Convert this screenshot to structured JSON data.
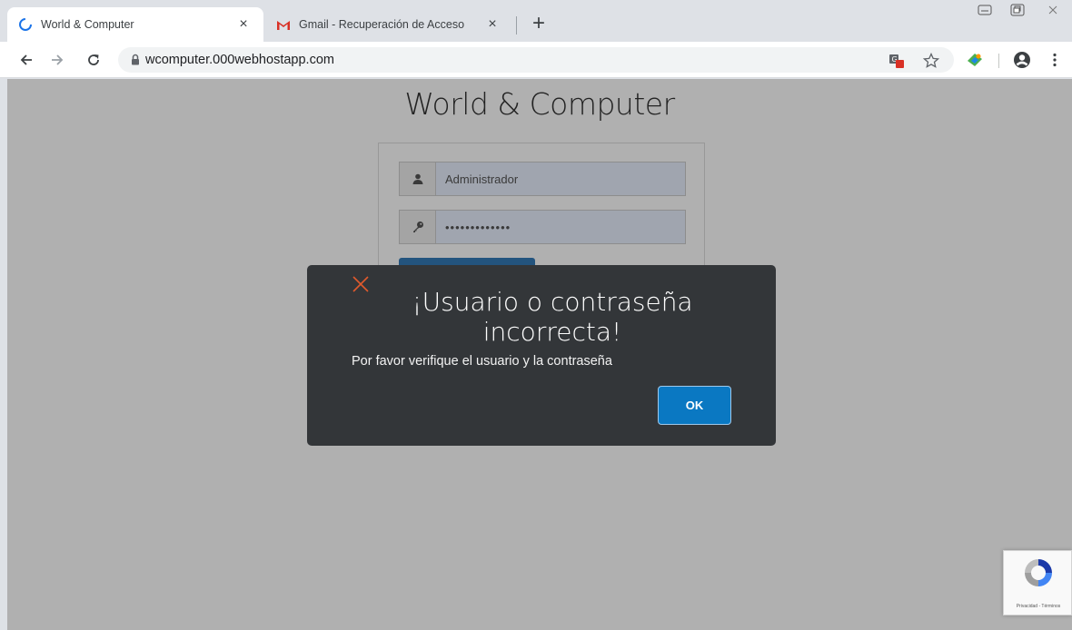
{
  "tabs": [
    {
      "title": "World & Computer",
      "favicon": "loading-spinner-icon",
      "close": "×"
    },
    {
      "title": "Gmail - Recuperación de Acceso",
      "favicon": "gmail-icon",
      "close": "×"
    }
  ],
  "newtab_label": "+",
  "toolbar": {
    "url": "wcomputer.000webhostapp.com"
  },
  "page": {
    "site_title": "World & Computer",
    "username_value": "Administrador",
    "password_value": "•••••••••••••"
  },
  "dialog": {
    "title": "¡Usuario o contraseña incorrecta!",
    "message": "Por favor verifique el usuario y la contraseña",
    "ok_label": "OK"
  },
  "recaptcha": {
    "footer": "Privacidad - Términos"
  },
  "colors": {
    "dialog_bg": "#333639",
    "ok_button": "#0a78c2",
    "close_x": "#e05a2c"
  }
}
